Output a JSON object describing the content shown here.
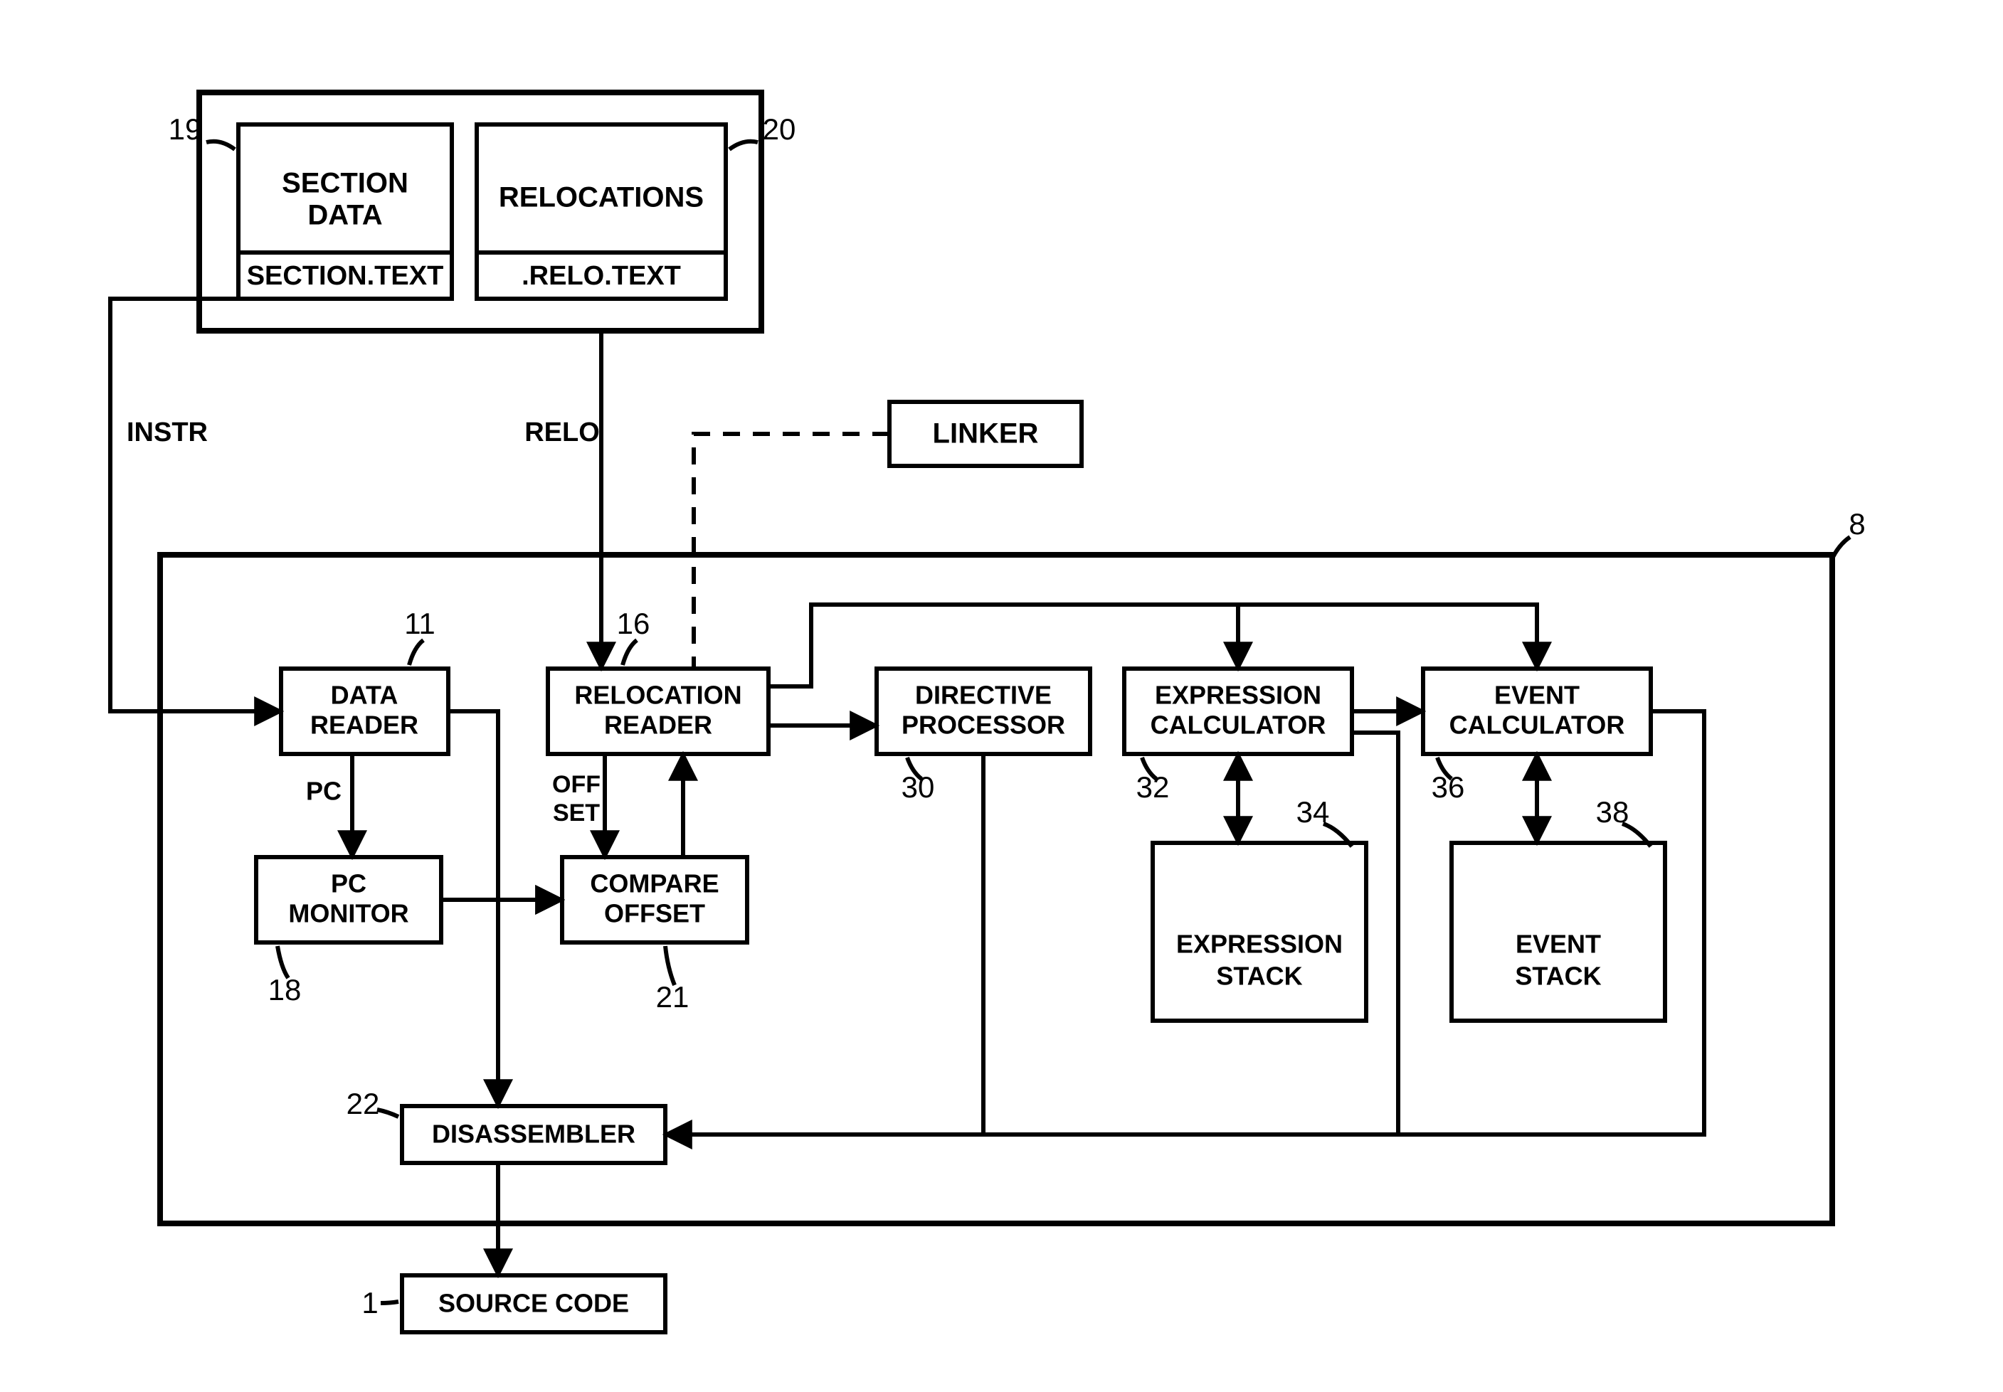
{
  "blocks": {
    "section_data_top": "SECTION",
    "section_data_bottom": "DATA",
    "section_text": "SECTION.TEXT",
    "relocations": "RELOCATIONS",
    "relo_text": ".RELO.TEXT",
    "linker": "LINKER",
    "data_reader_top": "DATA",
    "data_reader_bottom": "READER",
    "relocation_reader_top": "RELOCATION",
    "relocation_reader_bottom": "READER",
    "directive_top": "DIRECTIVE",
    "directive_bottom": "PROCESSOR",
    "expression_calc_top": "EXPRESSION",
    "expression_calc_bottom": "CALCULATOR",
    "event_calc_top": "EVENT",
    "event_calc_bottom": "CALCULATOR",
    "pc_monitor_top": "PC",
    "pc_monitor_bottom": "MONITOR",
    "compare_offset_top": "COMPARE",
    "compare_offset_bottom": "OFFSET",
    "expression_stack_top": "EXPRESSION",
    "expression_stack_bottom": "STACK",
    "event_stack_top": "EVENT",
    "event_stack_bottom": "STACK",
    "disassembler": "DISASSEMBLER",
    "source_code": "SOURCE CODE"
  },
  "labels": {
    "instr": "INSTR",
    "relo": "RELO",
    "pc": "PC",
    "off": "OFF",
    "set": "SET"
  },
  "refs": {
    "n19": "19",
    "n20": "20",
    "n8": "8",
    "n11": "11",
    "n16": "16",
    "n30": "30",
    "n32": "32",
    "n34": "34",
    "n36": "36",
    "n38": "38",
    "n18": "18",
    "n21": "21",
    "n22": "22",
    "n1": "1"
  }
}
